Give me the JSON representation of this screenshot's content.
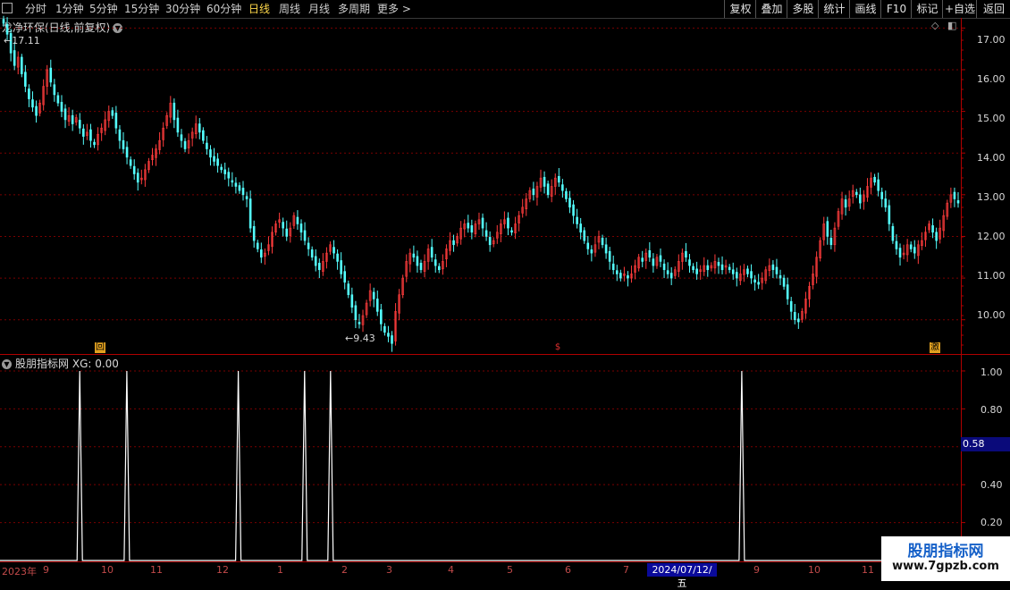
{
  "toolbar": {
    "periods": [
      "分时",
      "1分钟",
      "5分钟",
      "15分钟",
      "30分钟",
      "60分钟",
      "日线",
      "周线",
      "月线",
      "多周期",
      "更多"
    ],
    "active_period": "日线",
    "more_arrow": ">",
    "buttons": [
      "复权",
      "叠加",
      "多股",
      "统计",
      "画线",
      "F10",
      "+自选",
      "返回"
    ],
    "right_buttons_extra": "标记"
  },
  "main_panel": {
    "title": "龙净环保(日线,前复权)",
    "high_label": "17.11",
    "low_label": "9.43",
    "y_ticks": [
      "17.00",
      "16.00",
      "15.00",
      "14.00",
      "13.00",
      "12.00",
      "11.00",
      "10.00"
    ],
    "markers": [
      {
        "text": "回",
        "color": "#e0a020"
      },
      {
        "text": "$",
        "color": "#e03030"
      },
      {
        "text": "激",
        "color": "#e0a020"
      }
    ]
  },
  "indicator_panel": {
    "title": "股朋指标网",
    "value_label": "XG: 0.00",
    "y_ticks": [
      "1.00",
      "0.80",
      "0.40",
      "0.20"
    ],
    "cursor_value": "0.58"
  },
  "date_axis": {
    "labels": [
      "2023年",
      "9",
      "10",
      "11",
      "12",
      "1",
      "2",
      "3",
      "4",
      "5",
      "6",
      "7",
      "9",
      "10",
      "11"
    ],
    "selected_date": "2024/07/12/五"
  },
  "watermark": {
    "title": "股朋指标网",
    "url": "www.7gpzb.com"
  },
  "colors": {
    "up": "#ff3c3c",
    "down": "#54ffff",
    "grid": "#7a0000",
    "axis": "#b00000",
    "signal": "#ffffff"
  },
  "chart_data": [
    {
      "type": "candlestick",
      "title": "龙净环保(日线,前复权)",
      "ylim": [
        9.2,
        17.2
      ],
      "closes": [
        17.11,
        16.85,
        16.4,
        16.1,
        16.3,
        15.9,
        15.6,
        15.3,
        15.1,
        14.9,
        15.2,
        15.6,
        16.0,
        15.7,
        15.4,
        15.2,
        15.0,
        14.8,
        14.9,
        14.7,
        14.85,
        14.6,
        14.4,
        14.5,
        14.3,
        14.2,
        14.45,
        14.6,
        14.8,
        15.0,
        14.9,
        14.6,
        14.3,
        14.1,
        13.9,
        13.7,
        13.5,
        13.3,
        13.4,
        13.6,
        13.8,
        13.95,
        14.1,
        14.3,
        14.6,
        14.9,
        15.2,
        14.8,
        14.5,
        14.3,
        14.1,
        14.3,
        14.5,
        14.7,
        14.5,
        14.3,
        14.1,
        13.9,
        13.8,
        13.7,
        13.6,
        13.5,
        13.4,
        13.3,
        13.2,
        13.1,
        13.0,
        12.9,
        12.2,
        11.9,
        11.7,
        11.5,
        11.6,
        11.8,
        12.1,
        12.3,
        12.4,
        12.2,
        12.0,
        12.2,
        12.5,
        12.3,
        12.1,
        11.9,
        11.7,
        11.5,
        11.3,
        11.2,
        11.4,
        11.6,
        11.8,
        11.6,
        11.4,
        11.1,
        10.9,
        10.6,
        10.3,
        10.0,
        9.9,
        10.1,
        10.4,
        10.7,
        10.5,
        10.2,
        9.9,
        9.7,
        9.6,
        9.43,
        10.2,
        10.6,
        11.0,
        11.4,
        11.6,
        11.5,
        11.3,
        11.2,
        11.4,
        11.7,
        11.5,
        11.3,
        11.2,
        11.4,
        11.7,
        11.9,
        11.8,
        12.0,
        12.2,
        12.3,
        12.2,
        12.1,
        12.3,
        12.4,
        12.2,
        12.0,
        11.8,
        11.9,
        12.1,
        12.3,
        12.4,
        12.2,
        12.1,
        12.3,
        12.5,
        12.7,
        12.9,
        13.1,
        13.0,
        13.2,
        13.4,
        13.2,
        13.0,
        13.2,
        13.4,
        13.3,
        13.1,
        12.9,
        12.7,
        12.5,
        12.3,
        12.1,
        11.9,
        11.7,
        11.6,
        11.8,
        12.0,
        11.8,
        11.6,
        11.4,
        11.2,
        11.1,
        11.0,
        11.1,
        11.0,
        11.1,
        11.3,
        11.5,
        11.4,
        11.6,
        11.5,
        11.3,
        11.5,
        11.4,
        11.2,
        11.1,
        11.0,
        11.2,
        11.4,
        11.6,
        11.5,
        11.3,
        11.2,
        11.1,
        11.2,
        11.3,
        11.2,
        11.3,
        11.4,
        11.3,
        11.2,
        11.3,
        11.2,
        11.1,
        11.0,
        11.1,
        11.2,
        11.1,
        11.0,
        10.9,
        10.85,
        11.0,
        11.2,
        11.3,
        11.2,
        11.1,
        11.0,
        10.8,
        10.5,
        10.2,
        10.0,
        9.95,
        10.2,
        10.5,
        10.8,
        11.1,
        11.5,
        11.9,
        12.3,
        12.0,
        11.8,
        12.2,
        12.6,
        12.9,
        12.7,
        12.9,
        13.1,
        13.0,
        12.8,
        13.0,
        13.2,
        13.4,
        13.3,
        13.1,
        12.9,
        12.7,
        12.3,
        11.9,
        11.7,
        11.5,
        11.6,
        11.8,
        11.7,
        11.6,
        11.8,
        11.9,
        12.1,
        12.3,
        12.1,
        11.9,
        12.2,
        12.5,
        12.8,
        13.0,
        12.9,
        12.8
      ]
    },
    {
      "type": "line",
      "title": "股朋指标网",
      "ylim": [
        0,
        1.08
      ],
      "signal_positions": [
        0.083,
        0.132,
        0.248,
        0.317,
        0.344,
        0.772
      ],
      "signal_value": 1.0,
      "baseline": 0
    }
  ]
}
